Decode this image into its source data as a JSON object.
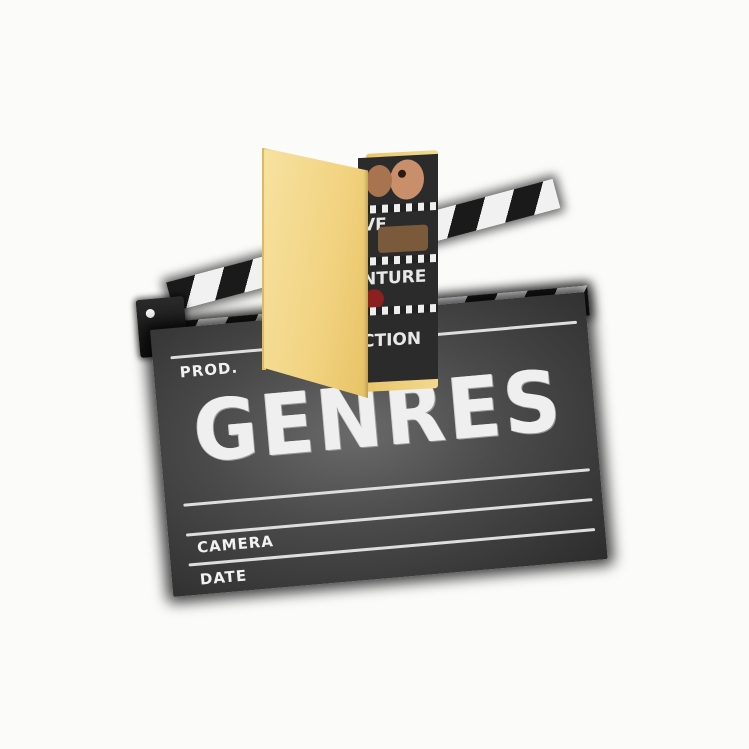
{
  "artwork": {
    "title": "GENRES",
    "labels": {
      "prod": "PROD.",
      "camera": "CAMERA",
      "date": "DATE"
    },
    "poster_partial_text": [
      "VE",
      "NTURE",
      "CTION"
    ]
  },
  "icons": [
    "clapperboard-icon",
    "folder-icon"
  ],
  "colors": {
    "background": "#fbfbfa",
    "board": "#4a4a4a",
    "text": "#efefef",
    "folder": "#f1d27f"
  }
}
